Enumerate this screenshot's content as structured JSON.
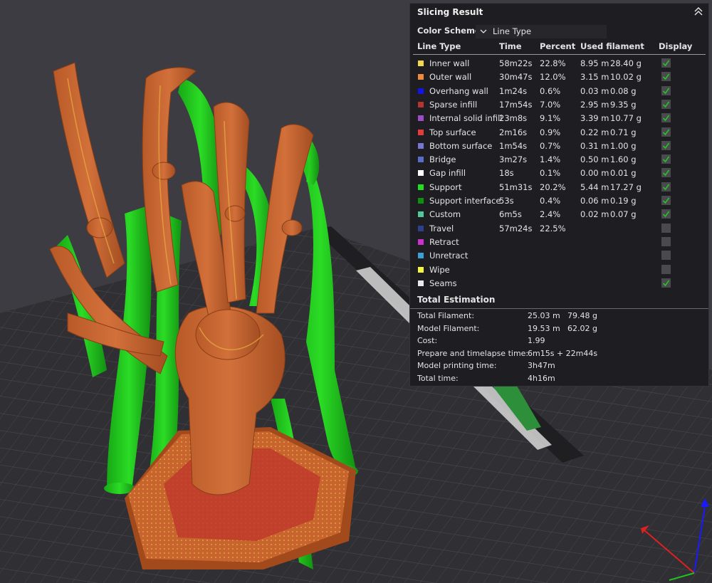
{
  "panel": {
    "title": "Slicing Result",
    "color_scheme_label": "Color Scheme",
    "color_scheme_value": "Line Type",
    "columns": {
      "line_type": "Line Type",
      "time": "Time",
      "percent": "Percent",
      "used_filament": "Used filament",
      "display": "Display"
    },
    "rows": [
      {
        "color": "#f3d84b",
        "name": "Inner wall",
        "time": "58m22s",
        "percent": "22.8%",
        "len": "8.95 m",
        "weight": "28.40 g",
        "display": true
      },
      {
        "color": "#ec8a3e",
        "name": "Outer wall",
        "time": "30m47s",
        "percent": "12.0%",
        "len": "3.15 m",
        "weight": "10.02 g",
        "display": true
      },
      {
        "color": "#1414e6",
        "name": "Overhang wall",
        "time": "1m24s",
        "percent": "0.6%",
        "len": "0.03 m",
        "weight": "0.08 g",
        "display": true
      },
      {
        "color": "#b83232",
        "name": "Sparse infill",
        "time": "17m54s",
        "percent": "7.0%",
        "len": "2.95 m",
        "weight": "9.35 g",
        "display": true
      },
      {
        "color": "#9a4fc8",
        "name": "Internal solid infill",
        "time": "23m8s",
        "percent": "9.1%",
        "len": "3.39 m",
        "weight": "10.77 g",
        "display": true
      },
      {
        "color": "#e23c3c",
        "name": "Top surface",
        "time": "2m16s",
        "percent": "0.9%",
        "len": "0.22 m",
        "weight": "0.71 g",
        "display": true
      },
      {
        "color": "#7676d4",
        "name": "Bottom surface",
        "time": "1m54s",
        "percent": "0.7%",
        "len": "0.31 m",
        "weight": "1.00 g",
        "display": true
      },
      {
        "color": "#5a6ec9",
        "name": "Bridge",
        "time": "3m27s",
        "percent": "1.4%",
        "len": "0.50 m",
        "weight": "1.60 g",
        "display": true
      },
      {
        "color": "#ffffff",
        "name": "Gap infill",
        "time": "18s",
        "percent": "0.1%",
        "len": "0.00 m",
        "weight": "0.01 g",
        "display": true
      },
      {
        "color": "#1ee01e",
        "name": "Support",
        "time": "51m31s",
        "percent": "20.2%",
        "len": "5.44 m",
        "weight": "17.27 g",
        "display": true
      },
      {
        "color": "#0e8f0e",
        "name": "Support interface",
        "time": "53s",
        "percent": "0.4%",
        "len": "0.06 m",
        "weight": "0.19 g",
        "display": true
      },
      {
        "color": "#4fc89a",
        "name": "Custom",
        "time": "6m5s",
        "percent": "2.4%",
        "len": "0.02 m",
        "weight": "0.07 g",
        "display": true
      },
      {
        "color": "#2e3f8c",
        "name": "Travel",
        "time": "57m24s",
        "percent": "22.5%",
        "len": "",
        "weight": "",
        "display": false
      },
      {
        "color": "#cc33cc",
        "name": "Retract",
        "time": "",
        "percent": "",
        "len": "",
        "weight": "",
        "display": false
      },
      {
        "color": "#3aa0d6",
        "name": "Unretract",
        "time": "",
        "percent": "",
        "len": "",
        "weight": "",
        "display": false
      },
      {
        "color": "#f5f53a",
        "name": "Wipe",
        "time": "",
        "percent": "",
        "len": "",
        "weight": "",
        "display": false
      },
      {
        "color": "#eaeaea",
        "name": "Seams",
        "time": "",
        "percent": "",
        "len": "",
        "weight": "",
        "display": true
      }
    ],
    "total_title": "Total Estimation",
    "totals": [
      {
        "label": "Total Filament:",
        "v1": "25.03 m",
        "v2": "79.48 g"
      },
      {
        "label": "Model Filament:",
        "v1": "19.53 m",
        "v2": "62.02 g"
      },
      {
        "label": "Cost:",
        "v1": "1.99",
        "v2": ""
      },
      {
        "label": "Prepare and timelapse time:",
        "v1": "6m15s + 22m44s",
        "v2": ""
      },
      {
        "label": "Model printing time:",
        "v1": "3h47m",
        "v2": ""
      },
      {
        "label": "Total time:",
        "v1": "4h16m",
        "v2": ""
      }
    ]
  },
  "colors": {
    "model_orange": "#c8642d",
    "support_green": "#22c81e",
    "bed_grid": "#33333a",
    "panel_bg": "#1e1e22"
  }
}
